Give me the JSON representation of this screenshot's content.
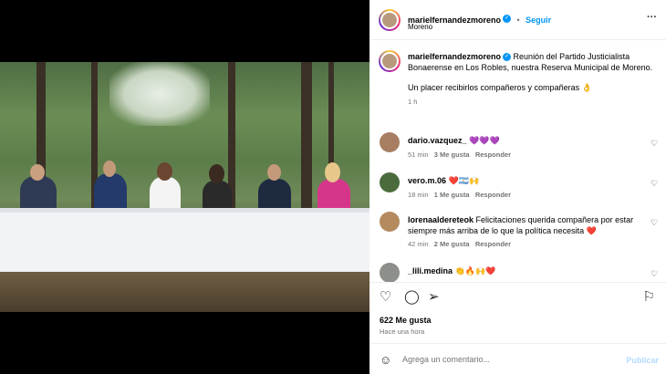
{
  "post": {
    "username": "marielfernandezmoreno",
    "location": "Moreno",
    "follow_label": "Seguir",
    "more_label": "···",
    "caption": "Reunión del Partido Justicialista Bonaerense en Los Robles, nuestra Reserva Municipal de Moreno.",
    "caption2": "Un placer recibirlos compañeros y compañeras 👌",
    "caption_time": "1 h",
    "likes": "622 Me gusta",
    "time": "Hace una hora",
    "comment_placeholder": "Agrega un comentario...",
    "publish_label": "Publicar"
  },
  "comments": [
    {
      "user": "dario.vazquez_",
      "text": "💜💜💜",
      "time": "51 min",
      "likes": "3 Me gusta",
      "reply": "Responder"
    },
    {
      "user": "vero.m.06",
      "text": "❤️🇦🇷🙌",
      "time": "18 min",
      "likes": "1 Me gusta",
      "reply": "Responder"
    },
    {
      "user": "lorenaaldereteok",
      "text": "Felicitaciones querida compañera por estar siempre más arriba de lo que la política necesita ❤️",
      "time": "42 min",
      "likes": "2 Me gusta",
      "reply": "Responder"
    },
    {
      "user": "_lili.medina",
      "text": "👏🔥🙌❤️",
      "time": "",
      "likes": "",
      "reply": ""
    }
  ],
  "colors": {
    "accent": "#0095f6",
    "verified": "#0095f6"
  }
}
